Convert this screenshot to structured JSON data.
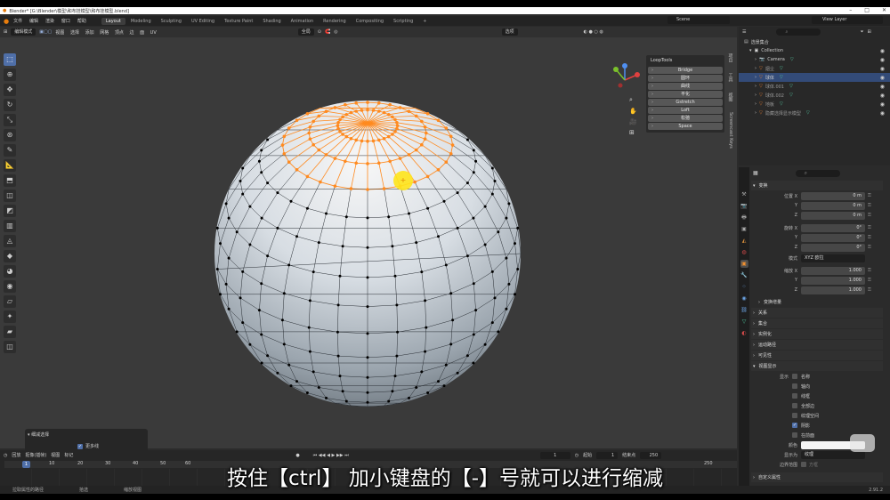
{
  "title_bar": {
    "text": "Blender* [G:\\Blender\\模型\\和布挂模型\\和布挂模型.blend]"
  },
  "top_menu": [
    "文件",
    "编辑",
    "渲染",
    "窗口",
    "帮助"
  ],
  "workspaces": [
    "Layout",
    "Modeling",
    "Sculpting",
    "UV Editing",
    "Texture Paint",
    "Shading",
    "Animation",
    "Rendering",
    "Compositing",
    "Scripting"
  ],
  "workspace_add": "+",
  "active_workspace": "Layout",
  "scene": "Scene",
  "view_layer": "View Layer",
  "viewport_header": {
    "mode": "编辑模式",
    "menus": [
      "视图",
      "选择",
      "添加",
      "网格",
      "顶点",
      "边",
      "面",
      "UV"
    ],
    "transform": "全局",
    "options": "选项"
  },
  "looptools": {
    "title": "LoopTools",
    "buttons": [
      "Bridge",
      "圆环",
      "曲线",
      "平化",
      "Gstretch",
      "Loft",
      "松弛",
      "Space"
    ]
  },
  "side_tabs": [
    "项目",
    "工具",
    "视图",
    "Screencast Keys"
  ],
  "redo_panel": {
    "title": "细减选择",
    "option": "更多线"
  },
  "timeline": {
    "menus": [
      "回放",
      "抠像(插帧)",
      "视图",
      "标记"
    ],
    "current_frame": "1",
    "start_label": "起始",
    "start": "1",
    "end_label": "结束点",
    "end": "250",
    "ticks": [
      "1",
      "10",
      "20",
      "30",
      "40",
      "50",
      "60",
      "250"
    ]
  },
  "statusbar": {
    "items": [
      "拉取属性的路径",
      "拾选",
      "缩放视图"
    ],
    "version": "2.91.2"
  },
  "outliner": {
    "header": "选景集合",
    "collection": "Collection",
    "rows": [
      {
        "name": "Camera",
        "type": "camera",
        "selected": false
      },
      {
        "name": "烟尘",
        "type": "mesh",
        "selected": false
      },
      {
        "name": "球体",
        "type": "mesh",
        "selected": true
      },
      {
        "name": "球体.001",
        "type": "mesh",
        "selected": false
      },
      {
        "name": "球体.002",
        "type": "mesh",
        "selected": false
      },
      {
        "name": "地板",
        "type": "mesh",
        "selected": false
      },
      {
        "name": "隐藏选择显示模型",
        "type": "mesh",
        "selected": false
      }
    ]
  },
  "properties": {
    "sec_transform": "变换",
    "location": {
      "label_x": "位置 X",
      "label_y": "Y",
      "label_z": "Z",
      "x": "0 m",
      "y": "0 m",
      "z": "0 m"
    },
    "rotation": {
      "label_x": "旋转 X",
      "label_y": "Y",
      "label_z": "Z",
      "x": "0°",
      "y": "0°",
      "z": "0°"
    },
    "mode_label": "模式",
    "mode_value": "XYZ 欧拉",
    "scale": {
      "label_x": "缩放 X",
      "label_y": "Y",
      "label_z": "Z",
      "x": "1.000",
      "y": "1.000",
      "z": "1.000"
    },
    "delta": "变换增量",
    "sections": [
      "关系",
      "集合",
      "实例化",
      "运动路径",
      "可见性",
      "视图显示"
    ],
    "display_label": "显示",
    "display_checks": [
      {
        "label": "名称",
        "checked": false
      },
      {
        "label": "轴向",
        "checked": false
      },
      {
        "label": "线框",
        "checked": false
      },
      {
        "label": "全部边",
        "checked": false
      },
      {
        "label": "纹理空间",
        "checked": false
      },
      {
        "label": "阴影",
        "checked": true
      },
      {
        "label": "在前面",
        "checked": false
      }
    ],
    "color_label": "颜色",
    "display_as_label": "显示为",
    "display_as_value": "纹理",
    "bounds_label": "边界范围",
    "bounds_value": "方框",
    "custom_props": "自定义属性"
  },
  "caption": "按住【ctrl】 加小键盘的【-】号就可以进行缩减",
  "colors": {
    "selected": "#ff8a1f",
    "accent": "#4f6fa8",
    "cursor": "#ffe41a"
  }
}
